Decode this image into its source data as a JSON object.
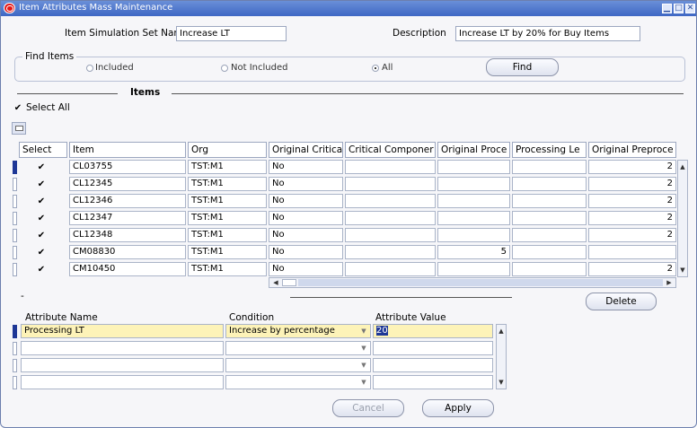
{
  "window": {
    "title": "Item Attributes Mass Maintenance"
  },
  "header": {
    "simulation_label": "Item Simulation Set Name",
    "simulation_value": "Increase LT",
    "description_label": "Description",
    "description_value": "Increase LT by 20% for Buy Items"
  },
  "find_items": {
    "label": "Find Items",
    "options": [
      "Included",
      "Not Included",
      "All"
    ],
    "selected": "All",
    "find_button": "Find"
  },
  "items_section": {
    "label": "Items",
    "select_all_label": "Select All",
    "select_all_checked": true
  },
  "items_table": {
    "columns": [
      "Select",
      "Item",
      "Org",
      "Original Critica",
      "Critical Componer",
      "Original Proce",
      "Processing Le",
      "Original Preproce"
    ],
    "rows": [
      {
        "selected": true,
        "item": "CL03755",
        "org": "TST:M1",
        "orig_critical": "No",
        "critical_component": "",
        "orig_processing": "",
        "processing_lead": "",
        "orig_preprocessing": "2"
      },
      {
        "selected": true,
        "item": "CL12345",
        "org": "TST:M1",
        "orig_critical": "No",
        "critical_component": "",
        "orig_processing": "",
        "processing_lead": "",
        "orig_preprocessing": "2"
      },
      {
        "selected": true,
        "item": "CL12346",
        "org": "TST:M1",
        "orig_critical": "No",
        "critical_component": "",
        "orig_processing": "",
        "processing_lead": "",
        "orig_preprocessing": "2"
      },
      {
        "selected": true,
        "item": "CL12347",
        "org": "TST:M1",
        "orig_critical": "No",
        "critical_component": "",
        "orig_processing": "",
        "processing_lead": "",
        "orig_preprocessing": "2"
      },
      {
        "selected": true,
        "item": "CL12348",
        "org": "TST:M1",
        "orig_critical": "No",
        "critical_component": "",
        "orig_processing": "",
        "processing_lead": "",
        "orig_preprocessing": "2"
      },
      {
        "selected": true,
        "item": "CM08830",
        "org": "TST:M1",
        "orig_critical": "No",
        "critical_component": "",
        "orig_processing": "5",
        "processing_lead": "",
        "orig_preprocessing": ""
      },
      {
        "selected": true,
        "item": "CM10450",
        "org": "TST:M1",
        "orig_critical": "No",
        "critical_component": "",
        "orig_processing": "",
        "processing_lead": "",
        "orig_preprocessing": "2"
      }
    ],
    "delete_button": "Delete"
  },
  "attributes_section": {
    "dash_label": "-"
  },
  "attributes_table": {
    "columns": [
      "Attribute Name",
      "Condition",
      "Attribute Value"
    ],
    "rows": [
      {
        "name": "Processing LT",
        "condition": "Increase by percentage",
        "value": "20"
      },
      {
        "name": "",
        "condition": "",
        "value": ""
      },
      {
        "name": "",
        "condition": "",
        "value": ""
      },
      {
        "name": "",
        "condition": "",
        "value": ""
      }
    ]
  },
  "footer": {
    "cancel_button": "Cancel",
    "apply_button": "Apply"
  }
}
